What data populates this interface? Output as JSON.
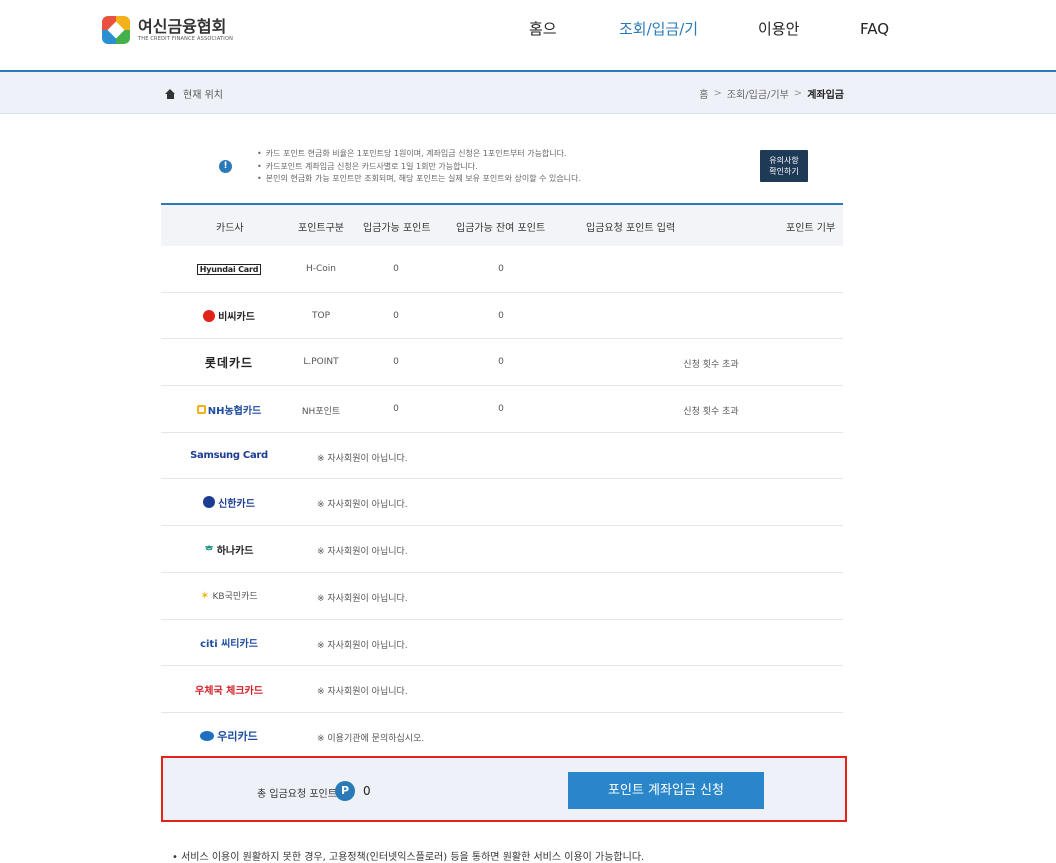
{
  "header": {
    "logo_kr": "여신금융협회",
    "logo_en": "THE CREDIT FINANCE ASSOCIATION",
    "nav": [
      "홈으로",
      "조회/입금/기부",
      "이용안내",
      "FAQ"
    ]
  },
  "breadcrumb": {
    "location_label": "현재 위치",
    "path": [
      "홈",
      "조회/입금/기부",
      "계좌입금"
    ]
  },
  "notice": {
    "lines": [
      "카드 포인트 현금화 비율은 1포인트당 1원이며, 계좌입금 신청은 1포인트부터 가능합니다.",
      "카드포인트 계좌입금 신청은 카드사별로 1일 1회만 가능합니다.",
      "본인의 현금화 가능 포인트만 조회되며, 해당 포인트는 실제 보유 포인트와 상이할 수 있습니다."
    ],
    "button_line1": "유의사항",
    "button_line2": "확인하기"
  },
  "table": {
    "headers": [
      "카드사",
      "포인트구분",
      "입금가능 포인트",
      "입금가능 잔여 포인트",
      "입금요청 포인트 입력",
      "포인트 기부"
    ],
    "rows": [
      {
        "brand": "Hyundai Card",
        "type": "H-Coin",
        "avail": "0",
        "remain": "0",
        "status": ""
      },
      {
        "brand": "비씨카드",
        "type": "TOP",
        "avail": "0",
        "remain": "0",
        "status": ""
      },
      {
        "brand": "롯데카드",
        "type": "L.POINT",
        "avail": "0",
        "remain": "0",
        "status": "신청 횟수 초과"
      },
      {
        "brand": "NH농협카드",
        "type": "NH포인트",
        "avail": "0",
        "remain": "0",
        "status": "신청 횟수 초과"
      },
      {
        "brand": "Samsung Card",
        "msg": "※ 자사회원이 아닙니다."
      },
      {
        "brand": "신한카드",
        "msg": "※ 자사회원이 아닙니다."
      },
      {
        "brand": "하나카드",
        "msg": "※ 자사회원이 아닙니다."
      },
      {
        "brand": "KB국민카드",
        "msg": "※ 자사회원이 아닙니다."
      },
      {
        "brand": "citi 씨티카드",
        "msg": "※ 자사회원이 아닙니다."
      },
      {
        "brand": "우체국 체크카드",
        "msg": "※ 자사회원이 아닙니다."
      },
      {
        "brand": "우리카드",
        "msg": "※ 이용기관에 문의하십시오."
      }
    ]
  },
  "total": {
    "label": "총 입금요청 포인트",
    "badge": "P",
    "value": "0",
    "submit_label": "포인트 계좌입금 신청"
  },
  "footnote": "• 서비스 이용이 원활하지 못한 경우, 고용정책(인터넷익스플로러) 등을 통하면 원활한 서비스 이용이 가능합니다."
}
